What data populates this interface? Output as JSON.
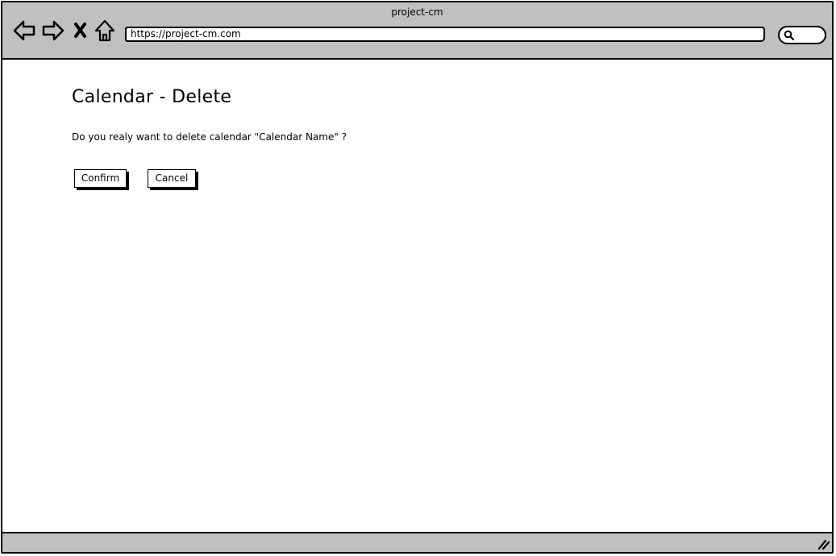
{
  "window": {
    "title": "project-cm"
  },
  "toolbar": {
    "back_icon": "back-arrow-icon",
    "forward_icon": "forward-arrow-icon",
    "stop_icon": "close-icon",
    "home_icon": "home-icon",
    "address": "https://project-cm.com",
    "search_icon": "search-icon"
  },
  "page": {
    "title": "Calendar - Delete",
    "message": "Do you realy want to delete calendar \"Calendar Name\" ?",
    "confirm_label": "Confirm",
    "cancel_label": "Cancel"
  },
  "statusbar": {
    "grip_icon": "resize-grip-icon"
  },
  "colors": {
    "chrome": "#c0c0c0",
    "border": "#000000",
    "background": "#ffffff"
  }
}
